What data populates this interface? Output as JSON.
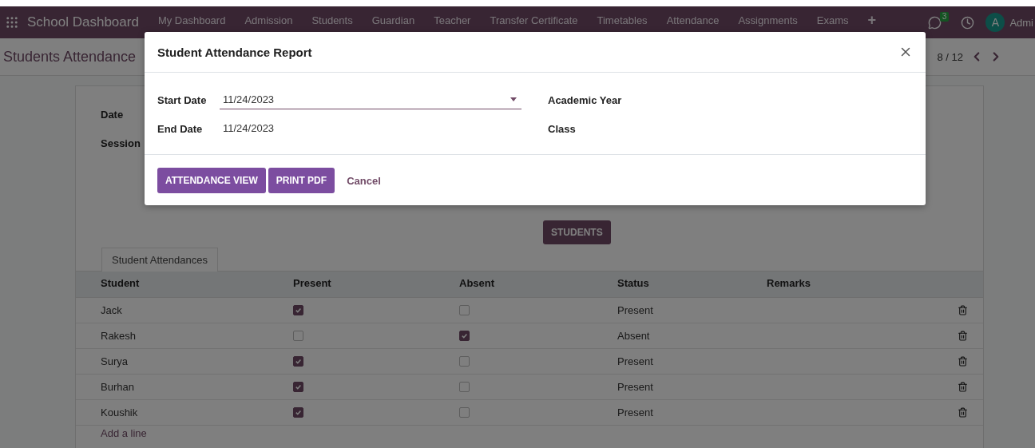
{
  "navbar": {
    "app_title": "School Dashboard",
    "menu": [
      "My Dashboard",
      "Admission",
      "Students",
      "Guardian",
      "Teacher",
      "Transfer Certificate",
      "Timetables",
      "Attendance",
      "Assignments",
      "Exams"
    ],
    "add_icon": "+",
    "chat_count": "3",
    "avatar_letter": "A",
    "user": "Admi"
  },
  "breadcrumb": "Students Attendance",
  "pager": "8 / 12",
  "form": {
    "fields": [
      "Date",
      "Session"
    ],
    "students_button": "STUDENTS",
    "tabs": [
      {
        "label": "Student Attendances",
        "selected": true
      }
    ],
    "columns": [
      "Student",
      "Present",
      "Absent",
      "Status",
      "Remarks"
    ],
    "rows": [
      {
        "student": "Jack",
        "present": true,
        "absent": false,
        "status": "Present"
      },
      {
        "student": "Rakesh",
        "present": false,
        "absent": true,
        "status": "Absent"
      },
      {
        "student": "Surya",
        "present": true,
        "absent": false,
        "status": "Present"
      },
      {
        "student": "Burhan",
        "present": true,
        "absent": false,
        "status": "Present"
      },
      {
        "student": "Koushik",
        "present": true,
        "absent": false,
        "status": "Present"
      }
    ],
    "add_line": "Add a line"
  },
  "dialog": {
    "title": "Student Attendance Report",
    "left_fields": [
      {
        "label": "Start Date",
        "value": "11/24/2023",
        "focused": true
      },
      {
        "label": "End Date",
        "value": "11/24/2023",
        "focused": false
      }
    ],
    "right_fields": [
      "Academic Year",
      "Class"
    ],
    "buttons": [
      "ATTENDANCE VIEW",
      "PRINT PDF"
    ],
    "cancel": "Cancel"
  }
}
